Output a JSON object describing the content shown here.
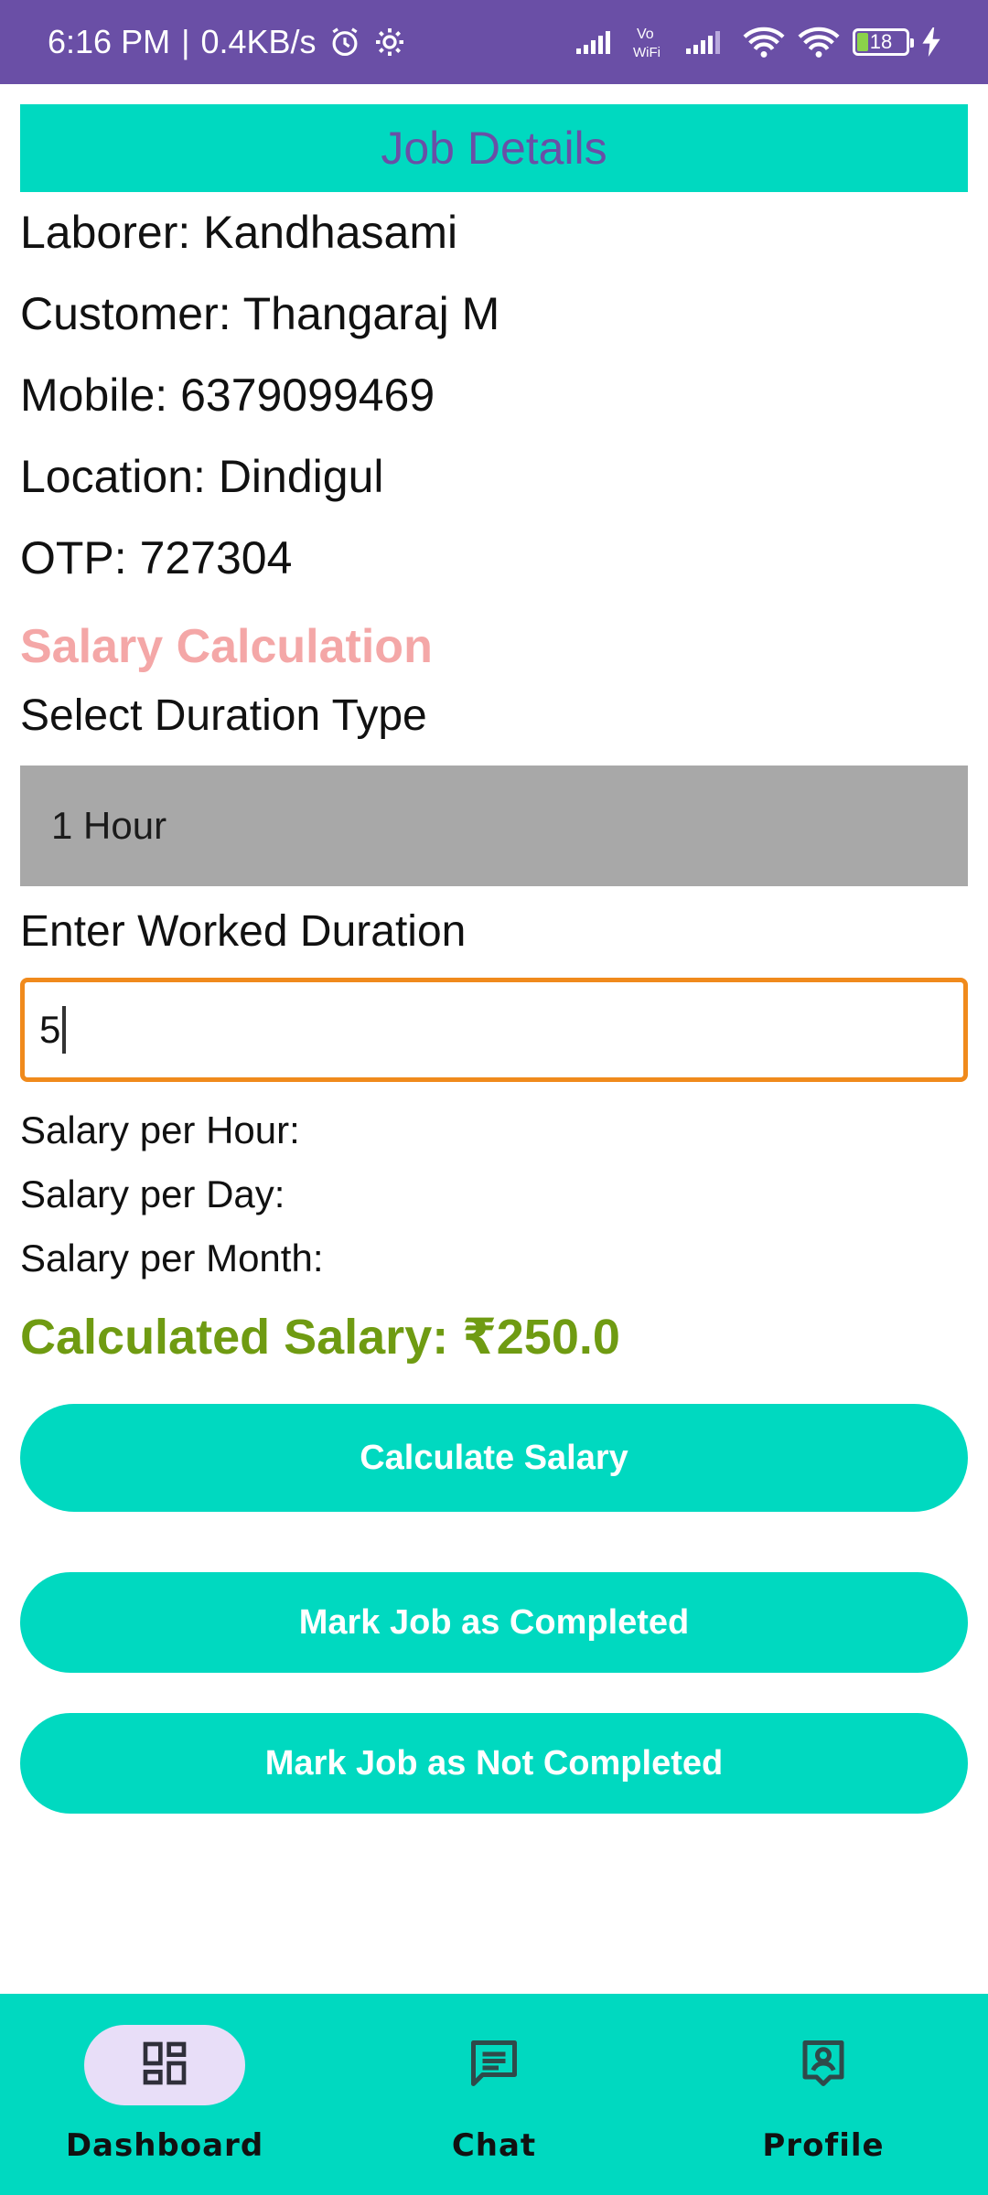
{
  "status_bar": {
    "time": "6:16 PM",
    "separator": "|",
    "speed": "0.4KB/s",
    "battery": "18"
  },
  "header": {
    "title": "Job Details"
  },
  "job": {
    "laborer": "Laborer: Kandhasami",
    "customer": "Customer: Thangaraj M",
    "mobile": "Mobile: 6379099469",
    "location": "Location: Dindigul",
    "otp": "OTP: 727304"
  },
  "salary": {
    "section_title": "Salary Calculation",
    "duration_type_label": "Select Duration Type",
    "duration_type_value": "1 Hour",
    "worked_duration_label": "Enter Worked Duration",
    "worked_duration_value": "5",
    "per_hour_label": "Salary per Hour:",
    "per_day_label": "Salary per Day:",
    "per_month_label": "Salary per Month:",
    "calculated": "Calculated Salary: ₹250.0"
  },
  "buttons": {
    "calculate": "Calculate Salary",
    "mark_completed": "Mark Job as Completed",
    "mark_not_completed": "Mark Job as Not Completed"
  },
  "bottom_nav": {
    "items": [
      {
        "label": "Dashboard",
        "icon": "dashboard-icon",
        "active": true
      },
      {
        "label": "Chat",
        "icon": "chat-icon",
        "active": false
      },
      {
        "label": "Profile",
        "icon": "profile-icon",
        "active": false
      }
    ]
  },
  "colors": {
    "status_bar": "#6a4fa6",
    "accent": "#00d9c0",
    "section_title": "#f4a7a7",
    "result": "#6f9b12",
    "input_border": "#f08a1c",
    "nav_active_pill": "#e8def8"
  }
}
